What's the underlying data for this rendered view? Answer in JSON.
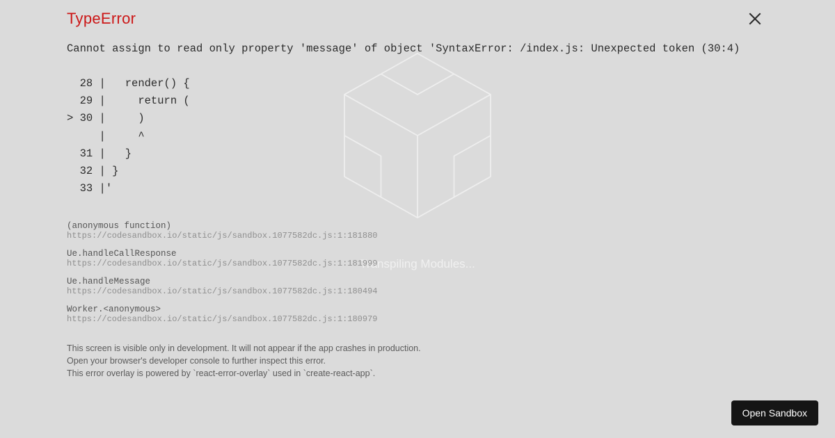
{
  "background": {
    "status_text": "Transpiling Modules..."
  },
  "error": {
    "title": "TypeError",
    "message": "Cannot assign to read only property 'message' of object 'SyntaxError: /index.js: Unexpected token (30:4)\n\n  28 |   render() {\n  29 |     return (\n> 30 |     )\n     |     ^\n  31 |   }\n  32 | }\n  33 |'",
    "stack": [
      {
        "fn": "(anonymous function)",
        "loc": "https://codesandbox.io/static/js/sandbox.1077582dc.js:1:181880"
      },
      {
        "fn": "Ue.handleCallResponse",
        "loc": "https://codesandbox.io/static/js/sandbox.1077582dc.js:1:181999"
      },
      {
        "fn": "Ue.handleMessage",
        "loc": "https://codesandbox.io/static/js/sandbox.1077582dc.js:1:180494"
      },
      {
        "fn": "Worker.<anonymous>",
        "loc": "https://codesandbox.io/static/js/sandbox.1077582dc.js:1:180979"
      }
    ],
    "notes": [
      "This screen is visible only in development. It will not appear if the app crashes in production.",
      "Open your browser's developer console to further inspect this error.",
      "This error overlay is powered by `react-error-overlay` used in `create-react-app`."
    ]
  },
  "actions": {
    "open_sandbox_label": "Open Sandbox"
  }
}
